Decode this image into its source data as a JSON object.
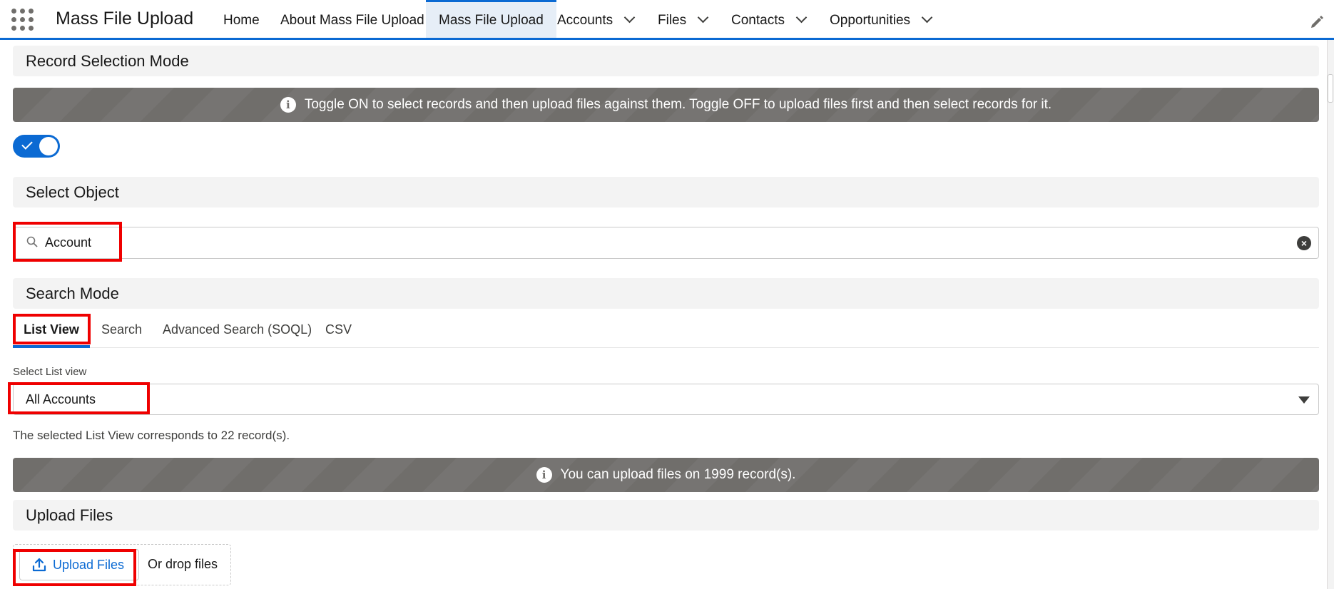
{
  "nav": {
    "app_name": "Mass File Upload",
    "items": [
      {
        "label": "Home"
      },
      {
        "label": "About Mass File Upload"
      },
      {
        "label": "Mass File Upload"
      },
      {
        "label": "Accounts"
      },
      {
        "label": "Files"
      },
      {
        "label": "Contacts"
      },
      {
        "label": "Opportunities"
      }
    ],
    "active_index": 2,
    "accent_color": "#0b6ad3"
  },
  "record_selection": {
    "title": "Record Selection Mode",
    "info": "Toggle ON to select records and then upload files against them. Toggle OFF to upload files first and then select records for it.",
    "toggle_on": true
  },
  "select_object": {
    "title": "Select Object",
    "value": "Account"
  },
  "search_mode": {
    "title": "Search Mode",
    "tabs": [
      "List View",
      "Search",
      "Advanced Search (SOQL)",
      "CSV"
    ],
    "active_tab": "List View",
    "select_label": "Select List view",
    "selected_list_view": "All Accounts",
    "record_note": "The selected List View corresponds to 22 record(s).",
    "upload_limit_info": "You can upload files on 1999 record(s)."
  },
  "upload_files": {
    "title": "Upload Files",
    "button_label": "Upload Files",
    "drop_text": "Or drop files"
  },
  "highlight_color": "#ef0000"
}
